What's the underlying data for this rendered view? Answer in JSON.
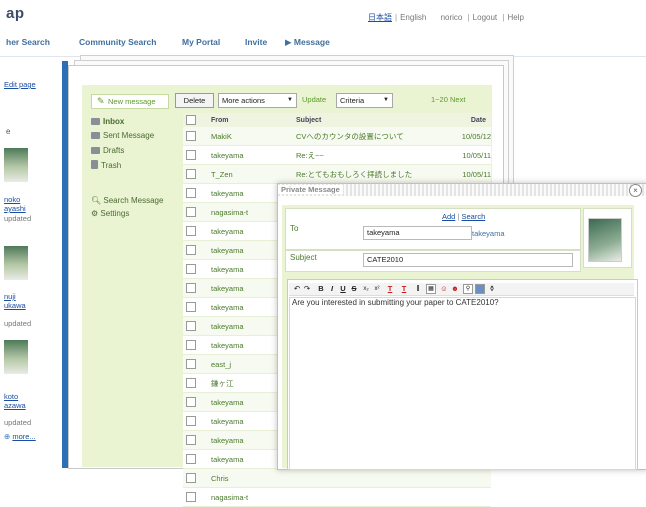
{
  "header": {
    "logo_fragment": "ap",
    "lang_jp": "日本語",
    "lang_sep": "|",
    "lang_en": "English",
    "user": "norico",
    "logout": "Logout",
    "help": "Help"
  },
  "nav": {
    "other_search": "her Search",
    "community_search": "Community Search",
    "my_portal": "My Portal",
    "invite": "Invite",
    "message": "▶ Message"
  },
  "sidebar": {
    "edit_page": "Edit page",
    "bullet_fragment": "e",
    "users": [
      {
        "line1": "noko",
        "line2": "ayashi",
        "status": "updated"
      },
      {
        "line1": "nuji",
        "line2": "ukawa",
        "status": "updated"
      },
      {
        "line1": "koto",
        "line2": "azawa",
        "status": "updated"
      }
    ],
    "more": "more..."
  },
  "mail": {
    "new_message": "New message",
    "folders": {
      "inbox": "Inbox",
      "sent": "Sent Message",
      "drafts": "Drafts",
      "trash": "Trash",
      "search": "Search Message",
      "settings": "Settings"
    },
    "toolbar": {
      "delete": "Delete",
      "more_actions": "More actions",
      "update": "Update",
      "criteria": "Criteria",
      "pager": "1~20 Next"
    },
    "columns": {
      "from": "From",
      "subject": "Subject",
      "date": "Date"
    },
    "rows": [
      {
        "from": "MakiK",
        "subject": "CVへのカウンタの設置について",
        "date": "10/05/12"
      },
      {
        "from": "takeyama",
        "subject": "Re:え~~",
        "date": "10/05/11"
      },
      {
        "from": "T_Zen",
        "subject": "Re:とてもおもしろく拝読しました",
        "date": "10/05/11"
      },
      {
        "from": "takeyama",
        "subject": "",
        "date": ""
      },
      {
        "from": "nagasima-t",
        "subject": "",
        "date": ""
      },
      {
        "from": "takeyama",
        "subject": "",
        "date": ""
      },
      {
        "from": "takeyama",
        "subject": "",
        "date": ""
      },
      {
        "from": "takeyama",
        "subject": "",
        "date": ""
      },
      {
        "from": "takeyama",
        "subject": "",
        "date": ""
      },
      {
        "from": "takeyama",
        "subject": "",
        "date": ""
      },
      {
        "from": "takeyama",
        "subject": "",
        "date": ""
      },
      {
        "from": "takeyama",
        "subject": "",
        "date": ""
      },
      {
        "from": "east_j",
        "subject": "",
        "date": ""
      },
      {
        "from": "鎌ヶ江",
        "subject": "",
        "date": ""
      },
      {
        "from": "takeyama",
        "subject": "",
        "date": ""
      },
      {
        "from": "takeyama",
        "subject": "",
        "date": ""
      },
      {
        "from": "takeyama",
        "subject": "",
        "date": ""
      },
      {
        "from": "takeyama",
        "subject": "",
        "date": ""
      },
      {
        "from": "Chris",
        "subject": "",
        "date": ""
      },
      {
        "from": "nagasima-t",
        "subject": "",
        "date": ""
      }
    ]
  },
  "modal": {
    "title": "Private Message",
    "close": "×",
    "to_label": "To",
    "add": "Add",
    "search": "Search",
    "to_value": "takeyama",
    "to_display": "takeyama",
    "subject_label": "Subject",
    "subject_value": "CATE2010",
    "body": "Are you interested in submitting your paper to CATE2010?"
  }
}
